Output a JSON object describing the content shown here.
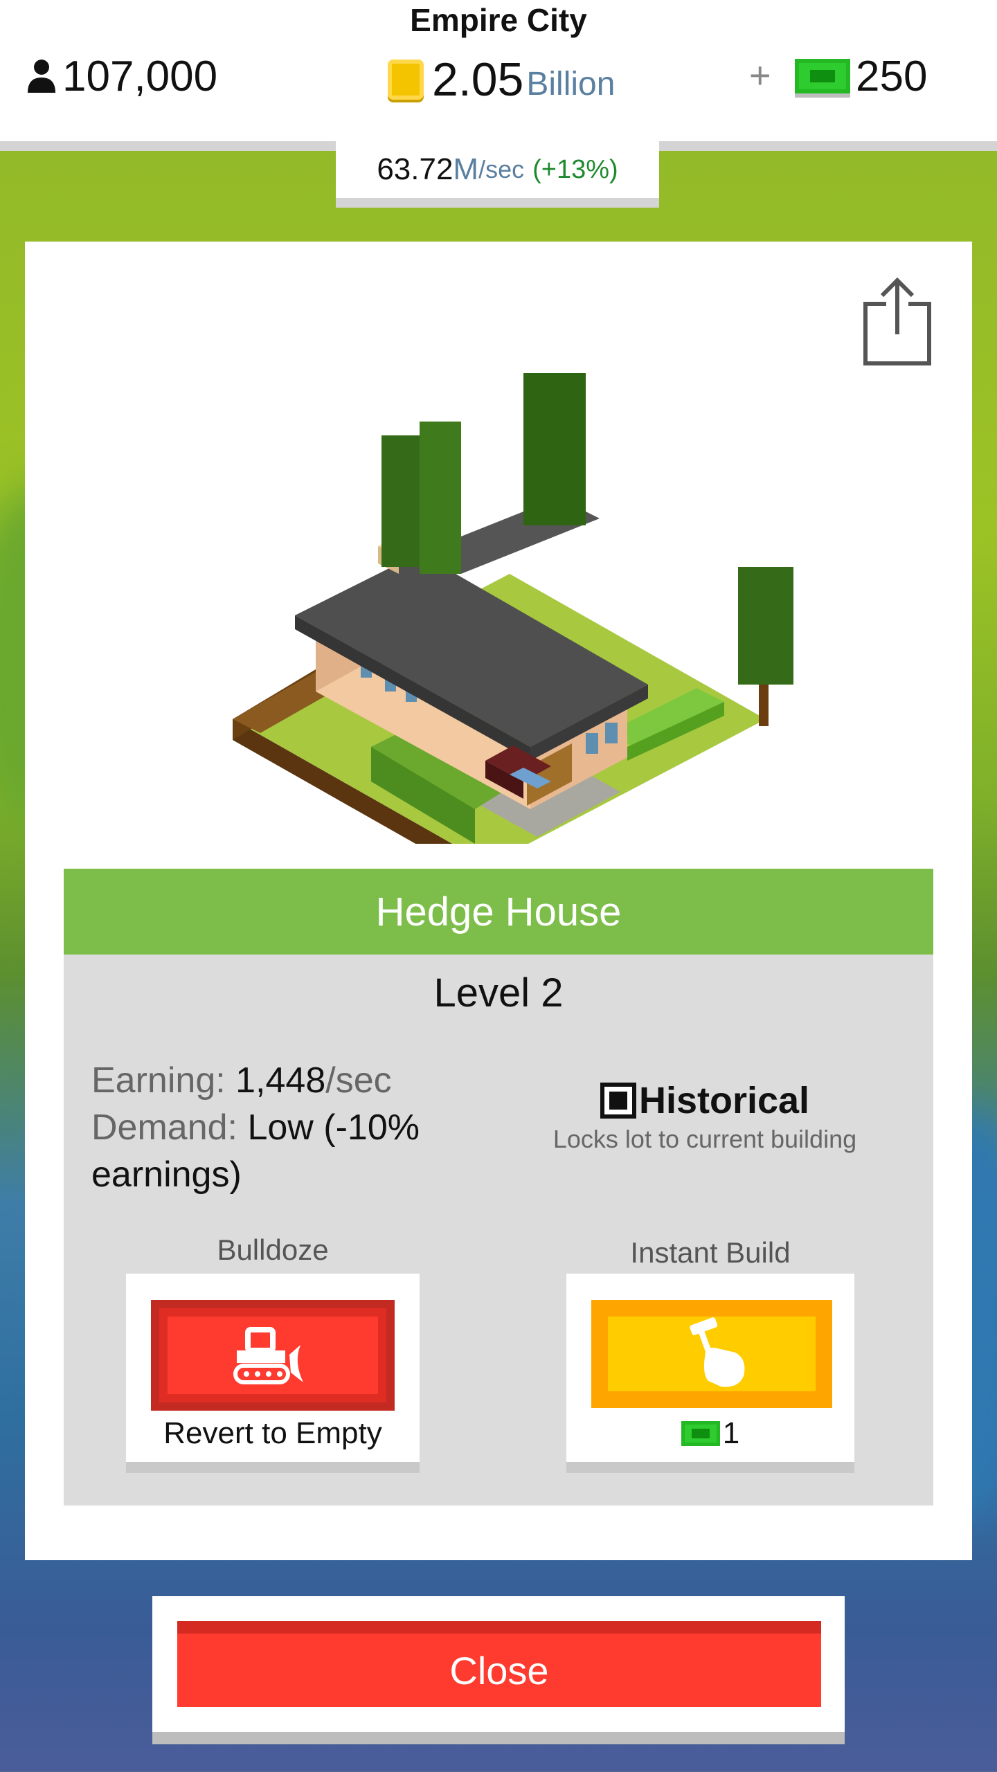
{
  "header": {
    "city_name": "Empire City",
    "population": "107,000",
    "money_value": "2.05",
    "money_unit": "Billion",
    "plus_label": "+",
    "cash_value": "250",
    "rate_value": "63.72",
    "rate_unit": "M",
    "rate_sec": "/sec",
    "rate_boost": "(+13%)"
  },
  "building": {
    "name": "Hedge House",
    "level": "Level 2",
    "earning_label": "Earning:",
    "earning_value": "1,448",
    "earning_unit": "/sec",
    "demand_label": "Demand:",
    "demand_value": "Low (-10% earnings)",
    "historical_label": "Historical",
    "historical_desc": "Locks lot to current building",
    "historical_checked": true
  },
  "actions": {
    "bulldoze_label": "Bulldoze",
    "bulldoze_button_text": "Revert to Empty",
    "instant_build_label": "Instant Build",
    "instant_build_cost": "1"
  },
  "footer": {
    "close_label": "Close"
  },
  "icons": {
    "population": "person-icon",
    "coin": "coin-icon",
    "cash": "cash-icon",
    "share": "share-icon",
    "bulldoze": "bulldozer-icon",
    "build": "hammer-hand-icon"
  },
  "colors": {
    "banner_green": "#7dbe4a",
    "bulldoze_red": "#ff3b2f",
    "build_yellow": "#ffcc00",
    "close_red": "#ff3a2e"
  }
}
